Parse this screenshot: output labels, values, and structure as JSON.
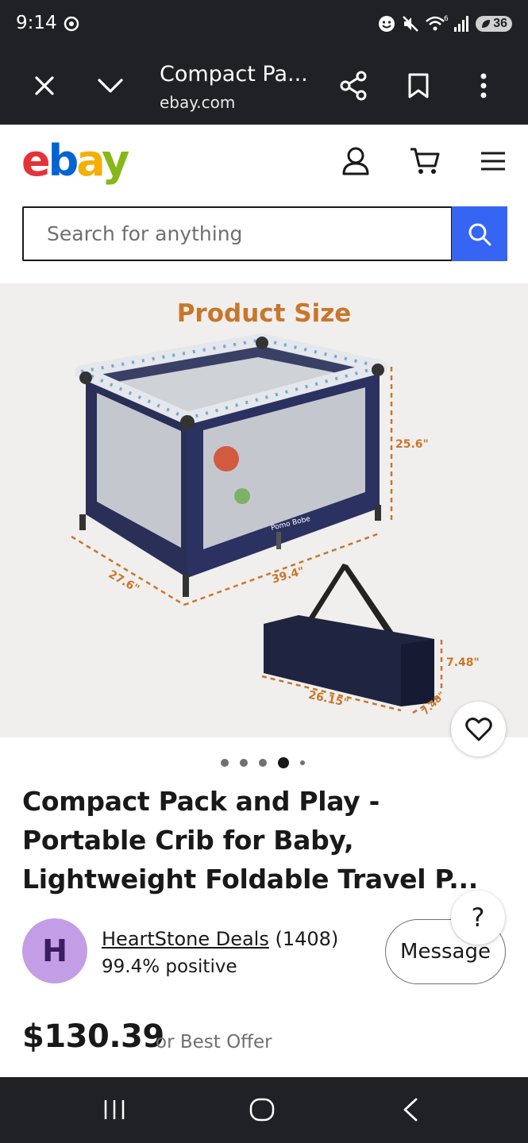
{
  "status_bar": {
    "time": "9:14",
    "signal_label": "6",
    "battery": "36"
  },
  "toolbar": {
    "title": "Compact Pa...",
    "url": "ebay.com"
  },
  "header": {
    "logo": [
      "e",
      "b",
      "a",
      "y"
    ],
    "search_placeholder": "Search for anything"
  },
  "product_image": {
    "heading": "Product Size",
    "dimensions": {
      "height": "25.6\"",
      "length": "39.4\"",
      "width": "27.6\"",
      "bag_height": "7.48\"",
      "bag_length": "26.15\"",
      "bag_depth": "7.48\""
    },
    "brand_on_product": "Pomo Bobe",
    "image_count": 5,
    "active_index": 4
  },
  "listing": {
    "title": "Compact Pack and Play - Portable Crib for Baby, Lightweight Foldable Travel P...",
    "seller_initial": "H",
    "seller_name": "HeartStone Deals",
    "seller_feedback": "(1408)",
    "seller_rating": "99.4% positive",
    "message_label": "Message",
    "help_label": "?",
    "price": "$130.39",
    "price_suffix": "or Best Offer"
  }
}
